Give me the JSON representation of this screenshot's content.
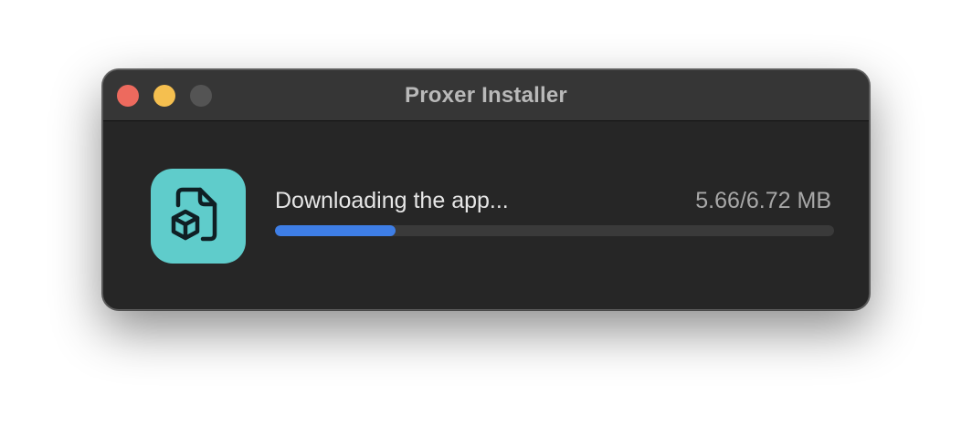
{
  "window": {
    "title": "Proxer Installer",
    "traffic_lights": {
      "close_color": "#ed6a5e",
      "minimize_color": "#f5bf4f",
      "zoom_color": "#545454"
    }
  },
  "app_icon": {
    "name": "package-file-icon",
    "background": "#5fcccb"
  },
  "download": {
    "status_text": "Downloading the app...",
    "size_text": "5.66/6.72 MB",
    "progress_fraction": 0.215,
    "accent_color": "#3e7ee6"
  }
}
